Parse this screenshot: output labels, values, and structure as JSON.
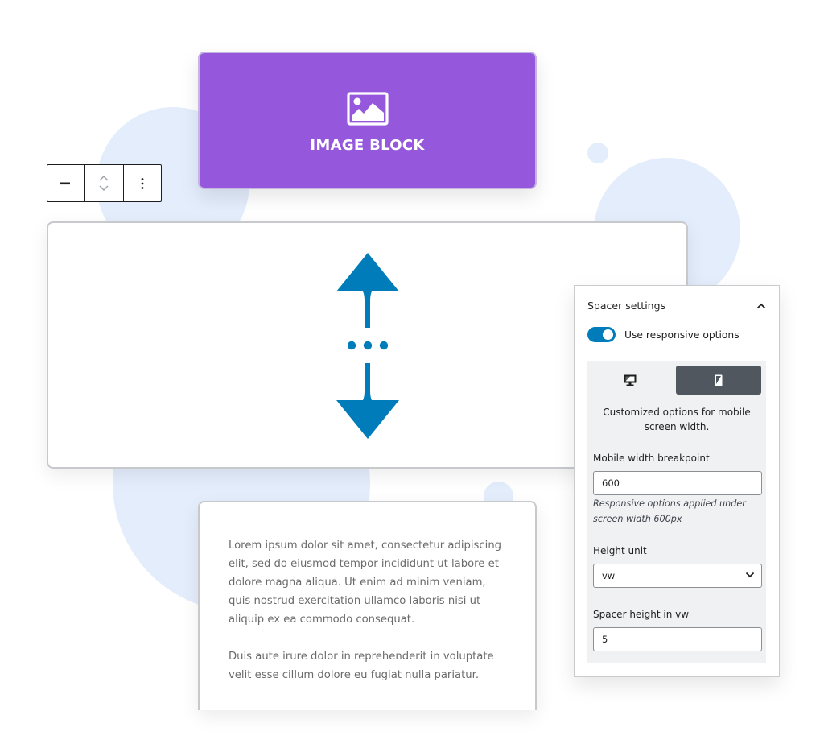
{
  "image_block": {
    "icon": "image-icon",
    "label": "IMAGE BLOCK",
    "background": "#9558dd"
  },
  "toolbar": {
    "buttons": [
      {
        "icon": "spacer-block-icon",
        "label": "Spacer block"
      },
      {
        "icon": "move-up-down-icon",
        "label": "Move"
      },
      {
        "icon": "more-options-icon",
        "label": "Options"
      }
    ]
  },
  "spacer_block": {
    "icon": "resize-vertical-icon",
    "accent": "#007cba"
  },
  "paragraph_block": {
    "paragraphs": [
      "Lorem ipsum dolor sit amet, consectetur adipiscing elit, sed do eiusmod tempor incididunt ut labore et dolore magna aliqua. Ut enim ad minim veniam, quis nostrud exercitation ullamco laboris nisi ut aliquip ex ea commodo consequat.",
      "Duis aute irure dolor in reprehenderit in voluptate velit esse cillum dolore eu fugiat nulla pariatur."
    ]
  },
  "settings_panel": {
    "title": "Spacer settings",
    "collapse_icon": "chevron-up-icon",
    "toggle": {
      "label": "Use responsive options",
      "checked": true
    },
    "device_tabs": [
      {
        "icon": "desktop-icon",
        "label": "Desktop",
        "active": false
      },
      {
        "icon": "mobile-icon",
        "label": "Mobile",
        "active": true
      }
    ],
    "description": "Customized options for mobile screen width.",
    "breakpoint": {
      "label": "Mobile width breakpoint",
      "value": "600",
      "help": "Responsive options applied under screen width 600px"
    },
    "height_unit": {
      "label": "Height unit",
      "value": "vw"
    },
    "spacer_height": {
      "label": "Spacer height in vw",
      "value": "5"
    }
  }
}
